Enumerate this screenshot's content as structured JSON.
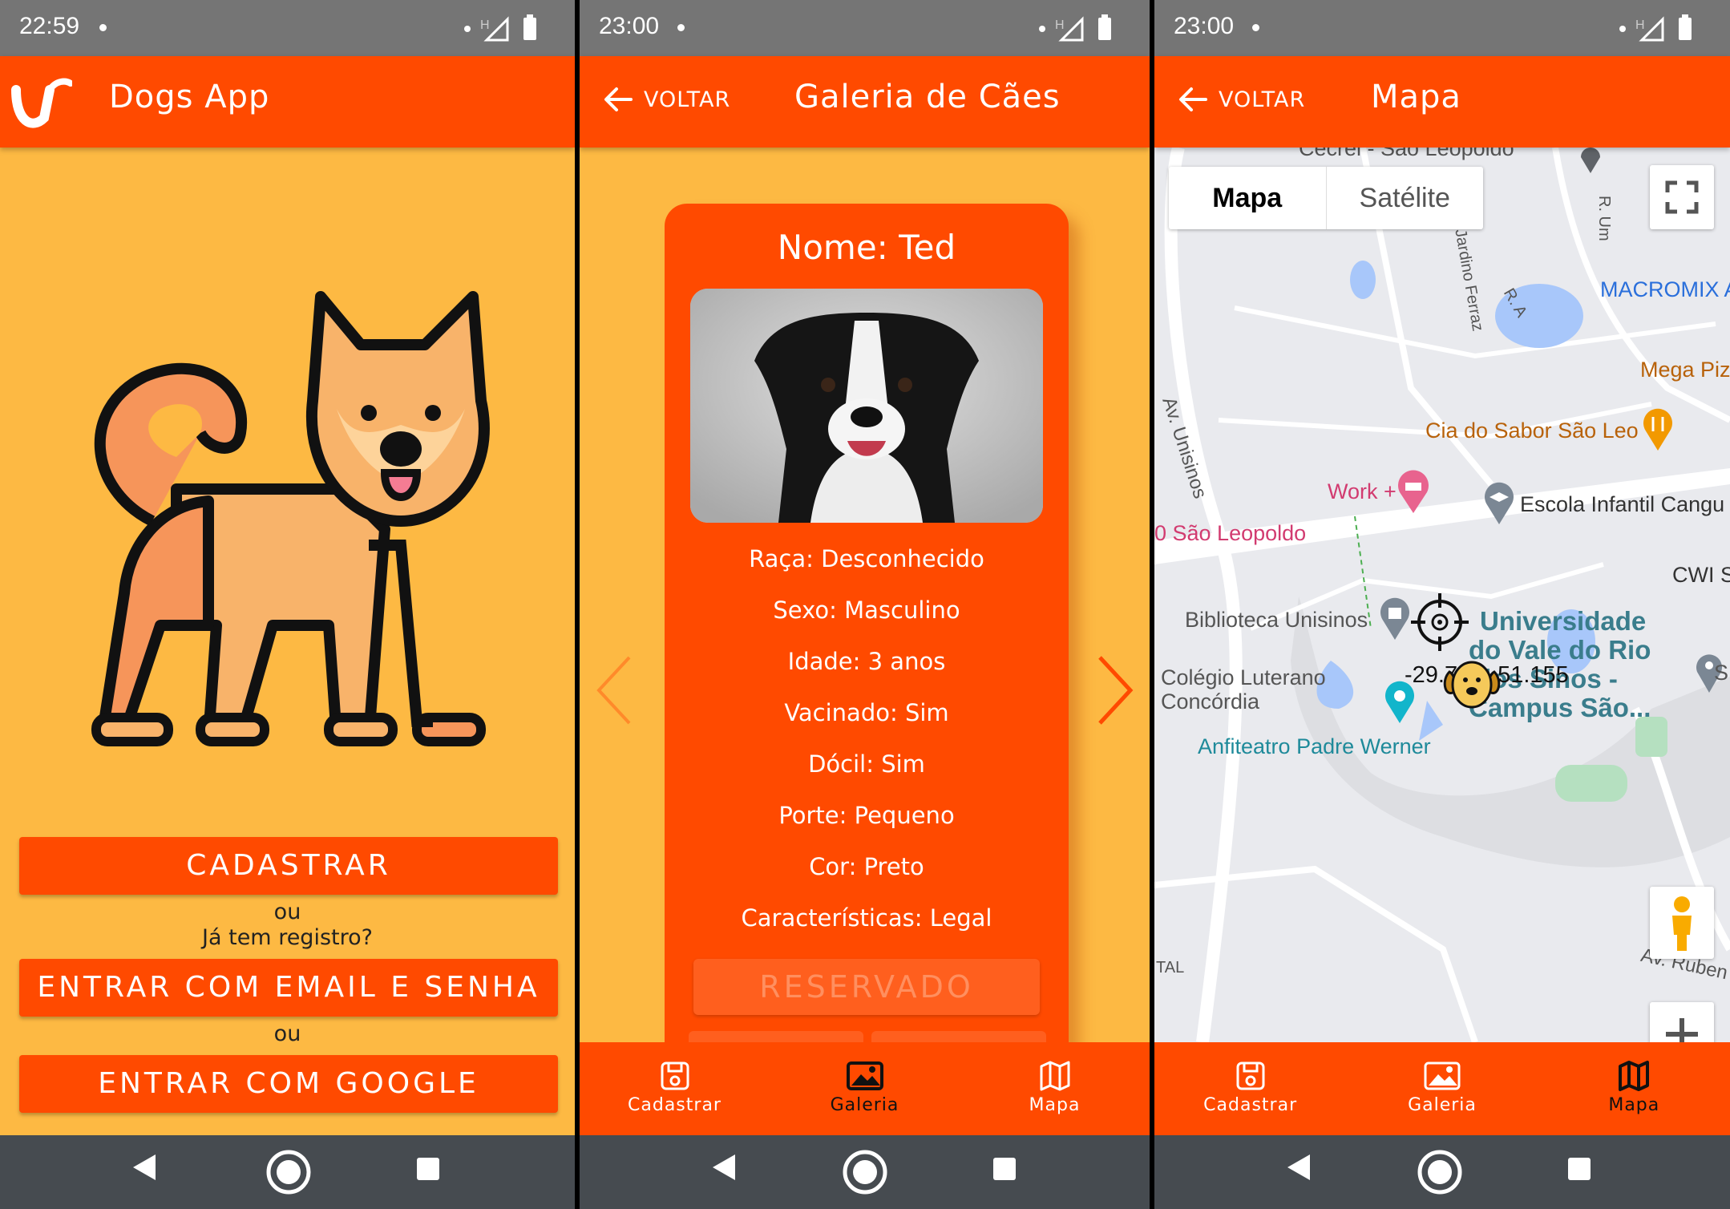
{
  "screen1": {
    "status": {
      "time": "22:59"
    },
    "app_title": "Dogs App",
    "btn_register": "CADASTRAR",
    "or1": "ou",
    "already": "Já tem registro?",
    "btn_email": "ENTRAR COM EMAIL E SENHA",
    "or2": "ou",
    "btn_google": "ENTRAR COM GOOGLE"
  },
  "screen2": {
    "status": {
      "time": "23:00"
    },
    "back_label": "VOLTAR",
    "title": "Galeria de Cães",
    "card": {
      "name": "Nome: Ted",
      "breed": "Raça: Desconhecido",
      "sex": "Sexo: Masculino",
      "age": "Idade: 3 anos",
      "vaccinated": "Vacinado: Sim",
      "docile": "Dócil: Sim",
      "size": "Porte: Pequeno",
      "color": "Cor: Preto",
      "traits": "Características: Legal",
      "reserved": "RESERVADO"
    },
    "tabs": {
      "register": "Cadastrar",
      "gallery": "Galeria",
      "map": "Mapa"
    }
  },
  "screen3": {
    "status": {
      "time": "23:00"
    },
    "back_label": "VOLTAR",
    "title": "Mapa",
    "map_type": {
      "map": "Mapa",
      "satellite": "Satélite"
    },
    "labels": {
      "top_road": "Cecrei - São Leopoldo",
      "r_um": "R. Um",
      "jardino": "Jardino Ferraz",
      "r_a": "R. A",
      "macromix": "MACROMIX A",
      "mega": "Mega Piz",
      "cia": "Cia do Sabor São Leo",
      "av_unisinos": "Av. Unisinos",
      "work": "Work +",
      "escola": "Escola Infantil Cangu",
      "sao_leopoldo": "0 São Leopoldo",
      "cwi": "CWI S",
      "biblioteca": "Biblioteca Unisinos",
      "univ1": "Universidade",
      "univ2": "do Vale do Rio",
      "univ3": "dos Sinos -",
      "univ4": "Campus São...",
      "coord": "-29.796,-51.155",
      "colegio1": "Colégio Luterano",
      "colegio2": "Concórdia",
      "anfiteatro": "Anfiteatro Padre Werner",
      "tal": "TAL",
      "av_rubem": "Av. Ruben",
      "s_right": "S"
    },
    "tabs": {
      "register": "Cadastrar",
      "gallery": "Galeria",
      "map": "Mapa"
    }
  },
  "colors": {
    "primary": "#FF4A00",
    "background": "#FDB943",
    "statusbar": "#757575",
    "navbar": "#464B50"
  }
}
